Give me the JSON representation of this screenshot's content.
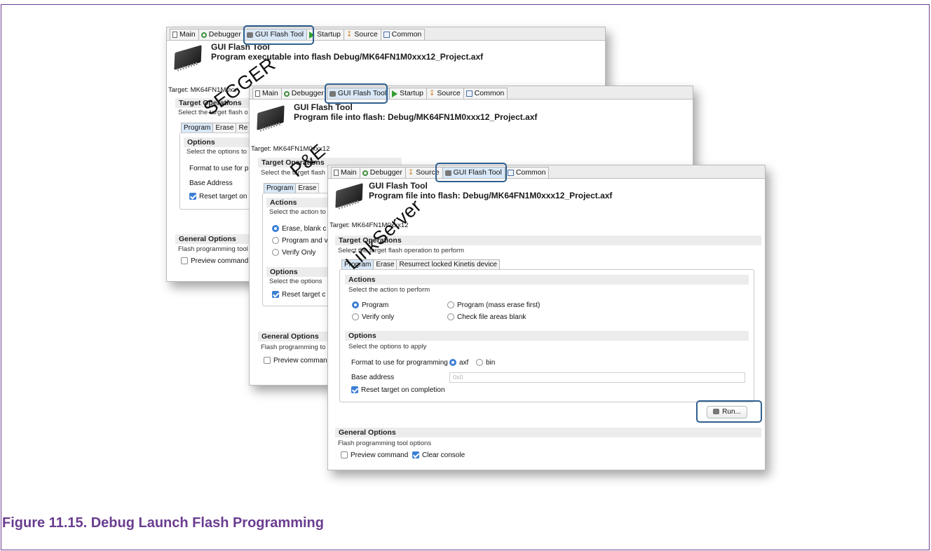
{
  "caption": "Figure 11.15. Debug Launch Flash Programming",
  "back": {
    "tabs": [
      "Main",
      "Debugger",
      "GUI Flash Tool",
      "Startup",
      "Source",
      "Common"
    ],
    "title": "GUI Flash Tool",
    "subtitle": "Program executable into flash Debug/MK64FN1M0xxx12_Project.axf",
    "target": "Target: MK64FN1M0xx",
    "sec_title": "Target Operations",
    "sec_sub": "Select the target flash o",
    "itabs": [
      "Program",
      "Erase",
      "Re"
    ],
    "options_title": "Options",
    "options_sub": "Select the options to",
    "format_label": "Format to use for pr",
    "base_label": "Base Address",
    "reset_label": "Reset target on",
    "general_title": "General Options",
    "general_sub": "Flash programming tool",
    "preview_label": "Preview command",
    "watermark": "SEGGER"
  },
  "middle": {
    "tabs": [
      "Main",
      "Debugger",
      "GUI Flash Tool",
      "Startup",
      "Source",
      "Common"
    ],
    "title": "GUI Flash Tool",
    "subtitle": "Program file into flash: Debug/MK64FN1M0xxx12_Project.axf",
    "target": "Target: MK64FN1M0xxx12",
    "sec_title": "Target Operations",
    "sec_sub": "Select the target flash",
    "itabs": [
      "Program",
      "Erase"
    ],
    "actions_title": "Actions",
    "actions_sub": "Select the action to",
    "radio1": "Erase, blank c",
    "radio2": "Program and v",
    "radio3": "Verify Only",
    "options_title": "Options",
    "options_sub": "Select the options",
    "reset_label": "Reset target c",
    "general_title": "General Options",
    "general_sub": "Flash programming to",
    "preview_label": "Preview comman",
    "watermark": "P&E"
  },
  "front": {
    "tabs": [
      "Main",
      "Debugger",
      "Source",
      "GUI Flash Tool",
      "Common"
    ],
    "title": "GUI Flash Tool",
    "subtitle": "Program file into flash: Debug/MK64FN1M0xxx12_Project.axf",
    "target": "Target: MK64FN1M0xxx12",
    "sec_title": "Target Operations",
    "sec_sub": "Select the target flash operation to perform",
    "itabs": [
      "Program",
      "Erase",
      "Resurrect locked Kinetis device"
    ],
    "actions_title": "Actions",
    "actions_sub": "Select the action to perform",
    "radio_program": "Program",
    "radio_verify": "Verify only",
    "radio_mass": "Program (mass erase first)",
    "radio_blank": "Check file areas blank",
    "options_title": "Options",
    "options_sub": "Select the options to apply",
    "format_label": "Format to use for programming",
    "fmt_axf": "axf",
    "fmt_bin": "bin",
    "base_label": "Base address",
    "base_placeholder": "0x0",
    "reset_label": "Reset target on completion",
    "run_label": "Run...",
    "general_title": "General Options",
    "general_sub": "Flash programming tool options",
    "preview_label": "Preview command",
    "clear_label": "Clear console",
    "watermark": "LinkServer"
  }
}
